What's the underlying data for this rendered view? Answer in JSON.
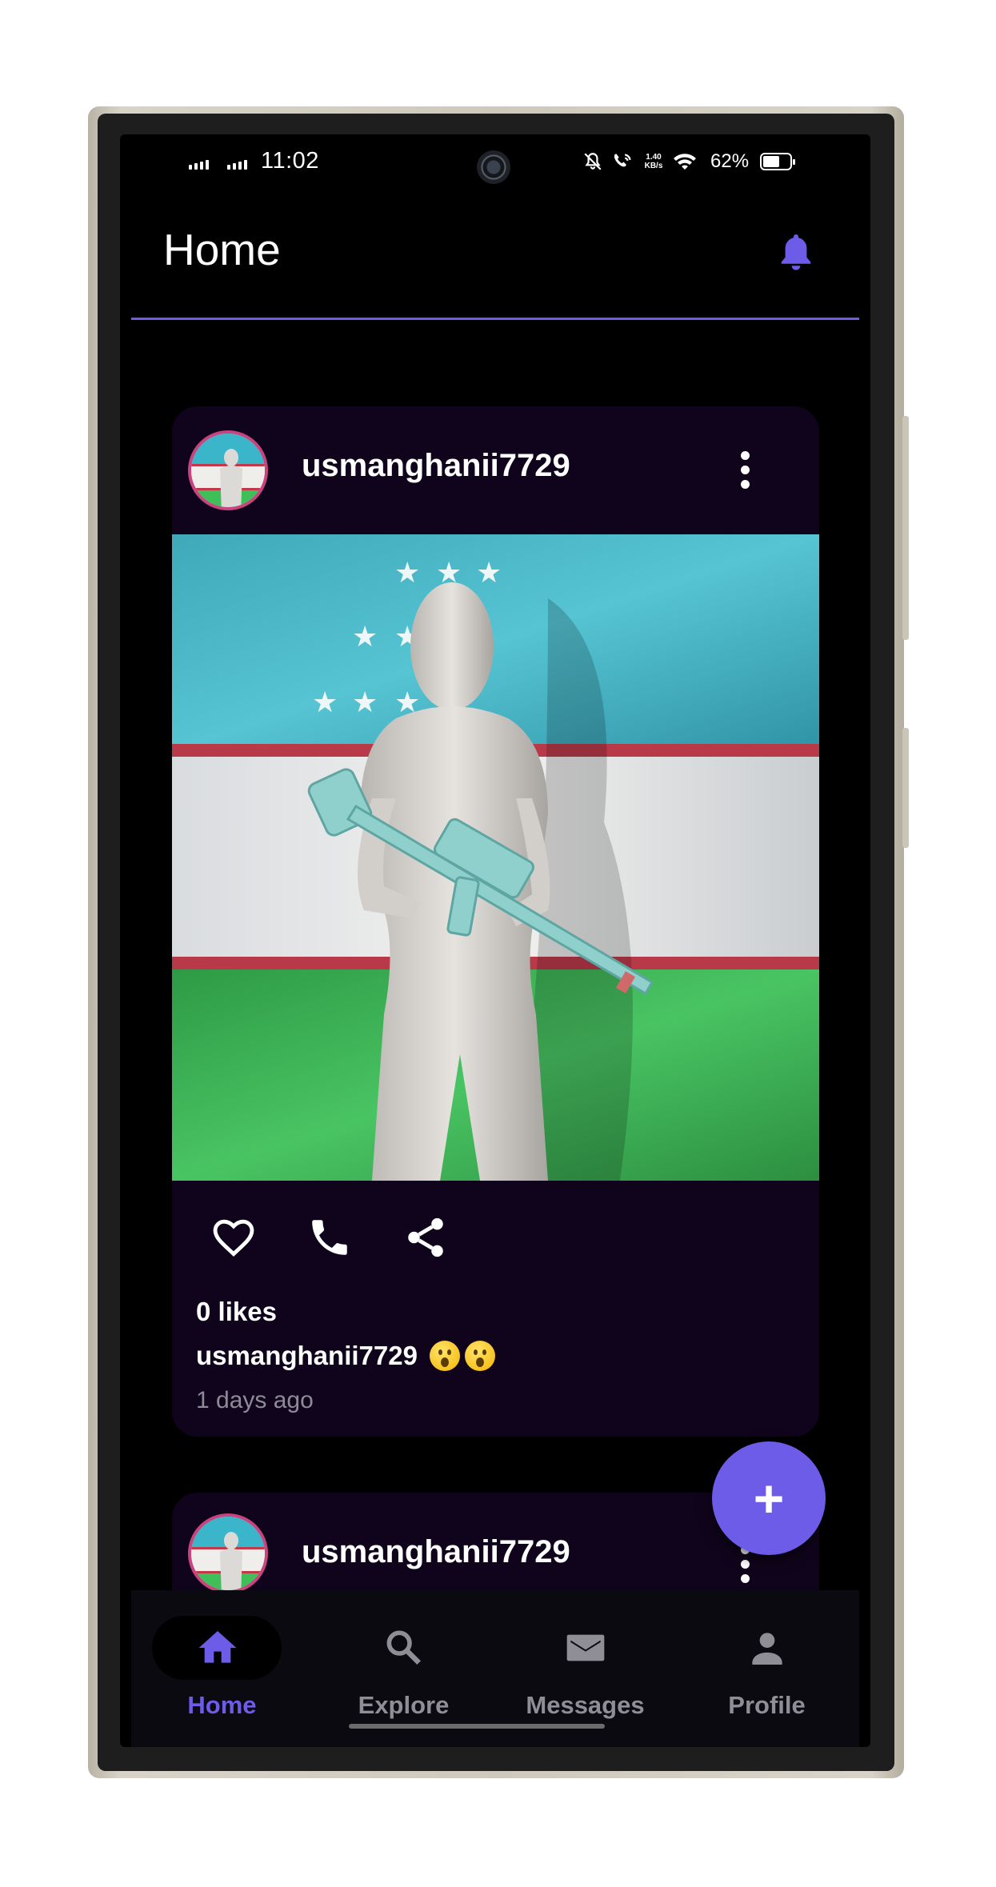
{
  "status_bar": {
    "time": "11:02",
    "net_speed_value": "1.40",
    "net_speed_unit": "KB/s",
    "battery_percent_text": "62%",
    "battery_level": 0.62
  },
  "app_bar": {
    "title": "Home",
    "action_icon": "notification-bell-icon",
    "accent_color": "#6c5ce7"
  },
  "feed": {
    "posts": [
      {
        "username": "usmanghanii7729",
        "image_description_icon": "post-image",
        "likes_text": "0 likes",
        "caption_user": "usmanghanii7729",
        "caption_emoji": "😮😮",
        "time_ago": "1 days ago",
        "actions": [
          "heart-icon",
          "phone-icon",
          "share-icon"
        ]
      },
      {
        "username": "usmanghanii7729"
      }
    ]
  },
  "fab": {
    "label": "+"
  },
  "bottom_nav": {
    "items": [
      {
        "label": "Home",
        "icon": "home-icon",
        "active": true
      },
      {
        "label": "Explore",
        "icon": "search-icon",
        "active": false
      },
      {
        "label": "Messages",
        "icon": "mail-icon",
        "active": false
      },
      {
        "label": "Profile",
        "icon": "person-icon",
        "active": false
      }
    ]
  },
  "colors": {
    "background": "#000000",
    "card": "#10041c",
    "accent": "#6c5ce7",
    "muted_text": "#8f8a98"
  }
}
